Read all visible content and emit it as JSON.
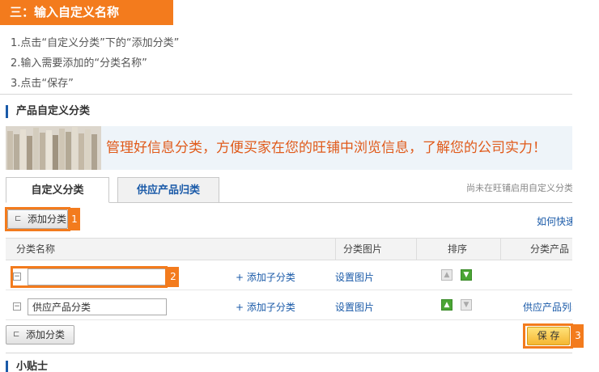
{
  "step_header": "三：输入自定义名称",
  "instructions": [
    "1.点击“自定义分类”下的“添加分类”",
    "2.输入需要添加的“分类名称”",
    "3.点击“保存”"
  ],
  "section_title": "产品自定义分类",
  "banner_text": "管理好信息分类，方便买家在您的旺铺中浏览信息，了解您的公司实力！",
  "tabs": [
    "自定义分类",
    "供应产品归类"
  ],
  "right_note": "尚未在旺铺启用自定义分类",
  "add_category_label": "添加分类",
  "howto_link": "如何快速",
  "table": {
    "headers": [
      "分类名称",
      "分类图片",
      "排序",
      "分类产品"
    ],
    "rows": [
      {
        "name": "",
        "add_sub": "+ 添加子分类",
        "set_image": "设置图片",
        "products": ""
      },
      {
        "name": "供应产品分类",
        "add_sub": "+ 添加子分类",
        "set_image": "设置图片",
        "products": "供应产品列表"
      }
    ]
  },
  "save_label": "保 存",
  "callouts": [
    "1",
    "2",
    "3"
  ],
  "tips_title": "小贴士",
  "colors": {
    "accent": "#f37b1d",
    "link": "#1a5aa8",
    "banner_text": "#e05a1a"
  },
  "icons": {
    "add": "tree-add-icon",
    "collapse": "minus-box-icon",
    "up": "arrow-up-icon",
    "down": "arrow-down-icon"
  }
}
